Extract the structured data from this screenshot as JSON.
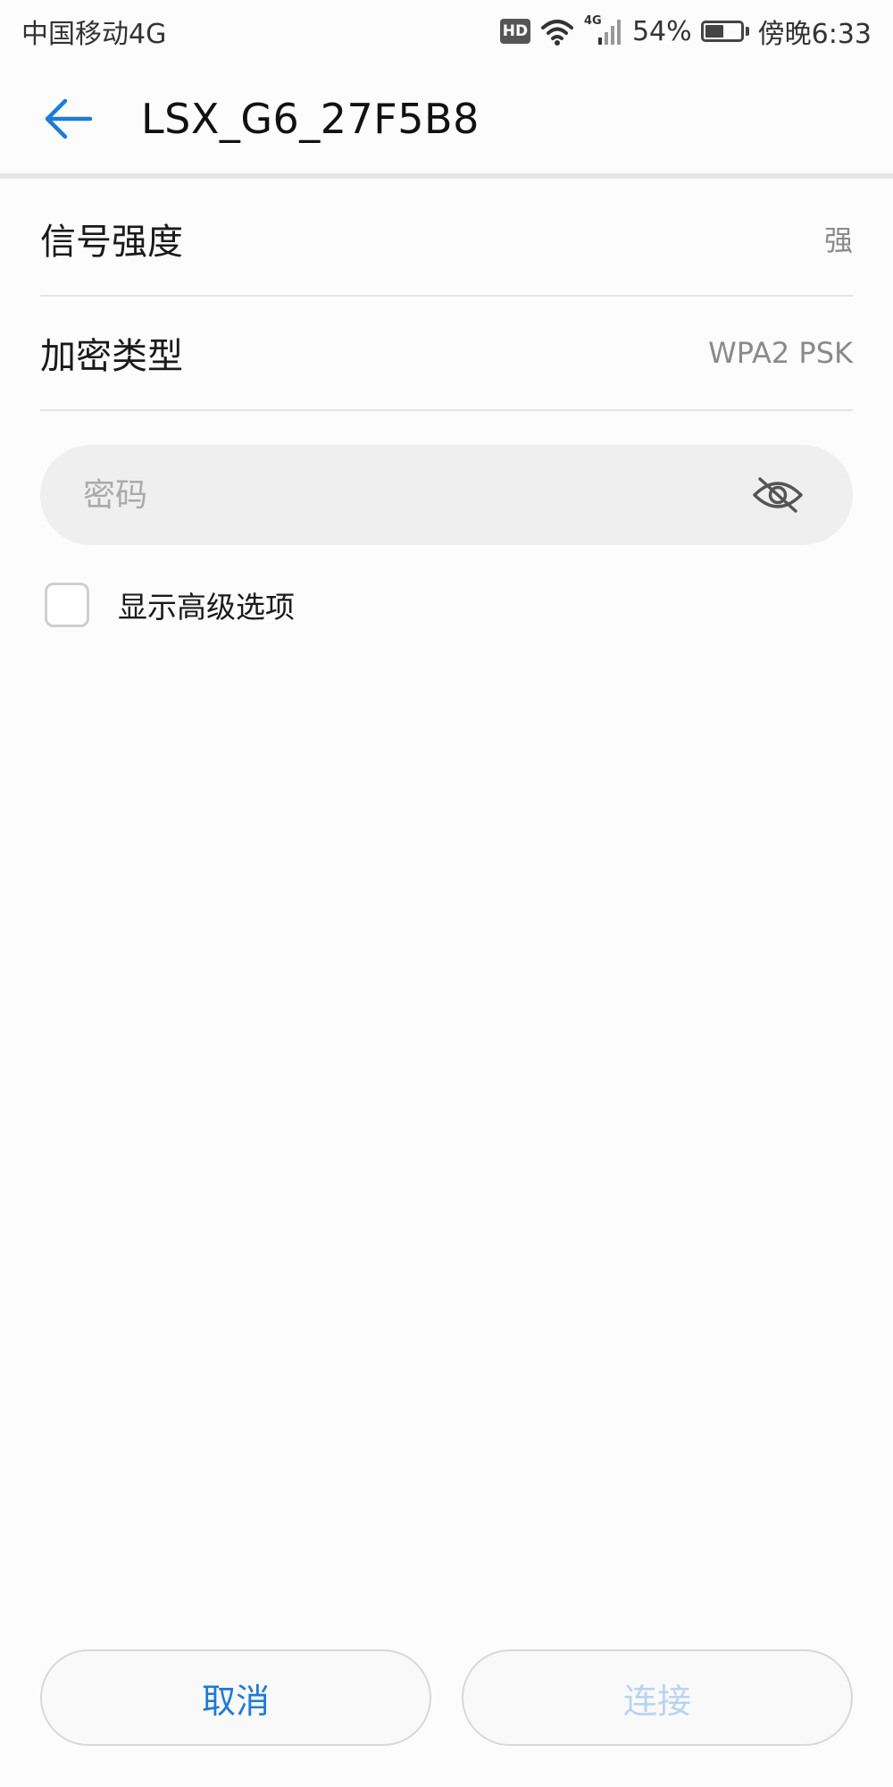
{
  "status_bar": {
    "carrier": "中国移动4G",
    "hd_badge": "HD",
    "network_type": "4G",
    "battery_percent": "54%",
    "battery_level": 0.54,
    "time": "傍晚6:33",
    "icons": [
      "hd-icon",
      "wifi-icon",
      "cell-signal-icon",
      "battery-icon"
    ]
  },
  "app_bar": {
    "title": "LSX_G6_27F5B8",
    "back_icon": "arrow-left-icon",
    "accent_color": "#1f7bd6"
  },
  "details": {
    "signal_strength": {
      "label": "信号强度",
      "value": "强"
    },
    "encryption": {
      "label": "加密类型",
      "value": "WPA2 PSK"
    }
  },
  "password": {
    "placeholder": "密码",
    "value": "",
    "toggle_icon": "eye-off-icon"
  },
  "advanced": {
    "label": "显示高级选项",
    "checked": false
  },
  "actions": {
    "cancel_label": "取消",
    "connect_label": "连接",
    "cancel_color": "#1f7bd6",
    "connect_disabled_color": "#b8d4f0"
  }
}
